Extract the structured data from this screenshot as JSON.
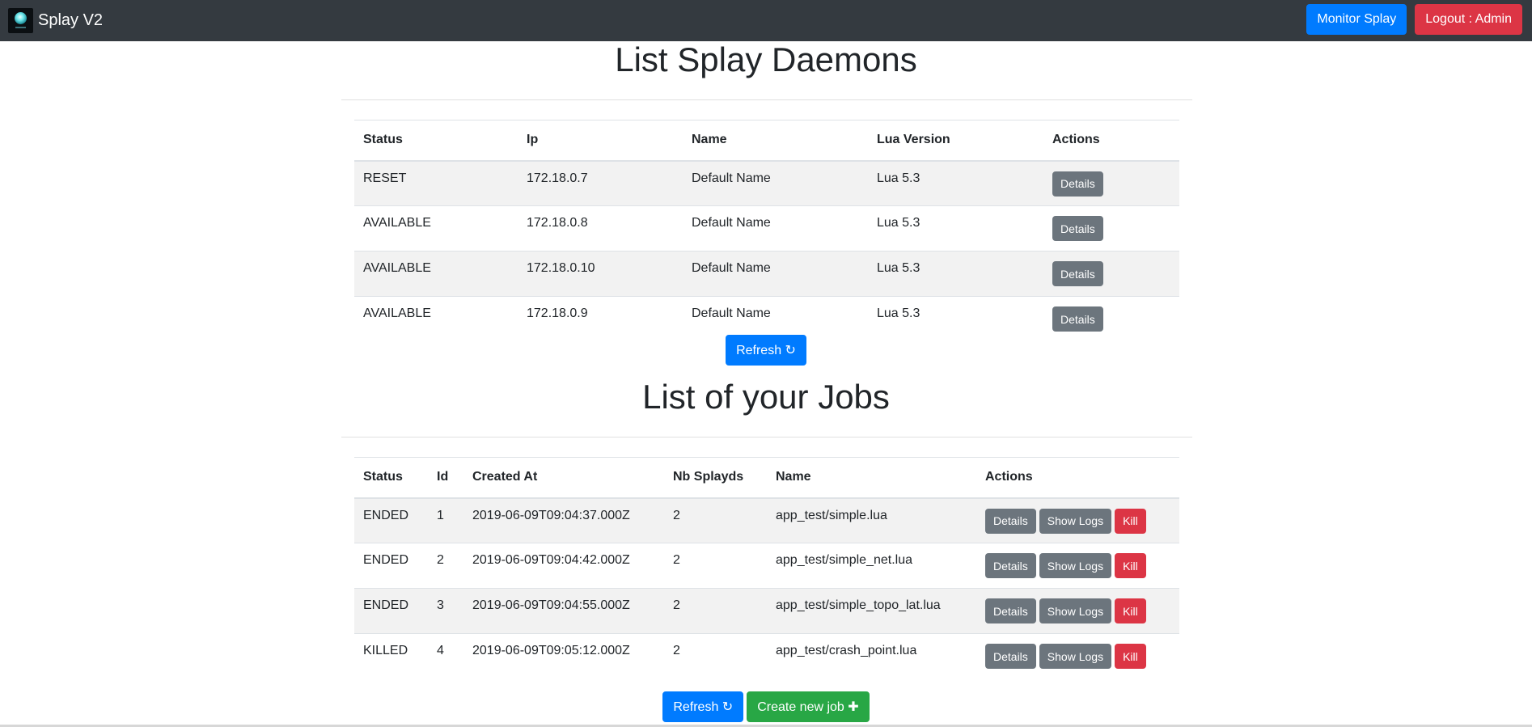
{
  "navbar": {
    "brand": "Splay V2",
    "logo_icon": "splay-logo-icon",
    "monitor_label": "Monitor Splay",
    "logout_label": "Logout : Admin"
  },
  "daemons": {
    "title": "List Splay Daemons",
    "columns": [
      "Status",
      "Ip",
      "Name",
      "Lua Version",
      "Actions"
    ],
    "rows": [
      {
        "status": "RESET",
        "ip": "172.18.0.7",
        "name": "Default Name",
        "lua": "Lua 5.3",
        "details": "Details"
      },
      {
        "status": "AVAILABLE",
        "ip": "172.18.0.8",
        "name": "Default Name",
        "lua": "Lua 5.3",
        "details": "Details"
      },
      {
        "status": "AVAILABLE",
        "ip": "172.18.0.10",
        "name": "Default Name",
        "lua": "Lua 5.3",
        "details": "Details"
      },
      {
        "status": "AVAILABLE",
        "ip": "172.18.0.9",
        "name": "Default Name",
        "lua": "Lua 5.3",
        "details": "Details"
      }
    ],
    "refresh_label": "Refresh ↻"
  },
  "jobs": {
    "title": "List of your Jobs",
    "columns": [
      "Status",
      "Id",
      "Created At",
      "Nb Splayds",
      "Name",
      "Actions"
    ],
    "rows": [
      {
        "status": "ENDED",
        "id": "1",
        "created": "2019-06-09T09:04:37.000Z",
        "nb": "2",
        "name": "app_test/simple.lua",
        "details": "Details",
        "logs": "Show Logs",
        "kill": "Kill"
      },
      {
        "status": "ENDED",
        "id": "2",
        "created": "2019-06-09T09:04:42.000Z",
        "nb": "2",
        "name": "app_test/simple_net.lua",
        "details": "Details",
        "logs": "Show Logs",
        "kill": "Kill"
      },
      {
        "status": "ENDED",
        "id": "3",
        "created": "2019-06-09T09:04:55.000Z",
        "nb": "2",
        "name": "app_test/simple_topo_lat.lua",
        "details": "Details",
        "logs": "Show Logs",
        "kill": "Kill"
      },
      {
        "status": "KILLED",
        "id": "4",
        "created": "2019-06-09T09:05:12.000Z",
        "nb": "2",
        "name": "app_test/crash_point.lua",
        "details": "Details",
        "logs": "Show Logs",
        "kill": "Kill"
      }
    ],
    "refresh_label": "Refresh ↻",
    "create_label": "Create new job ✚"
  },
  "colors": {
    "navbar": "#343a40",
    "primary": "#007bff",
    "danger": "#dc3545",
    "secondary": "#6c757d",
    "success": "#28a745"
  }
}
